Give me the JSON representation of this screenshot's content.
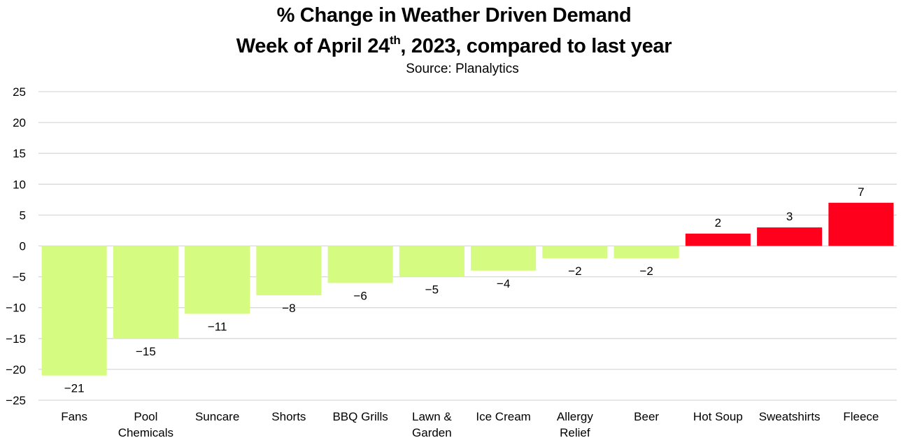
{
  "chart_data": {
    "type": "bar",
    "title": "% Change in Weather Driven Demand",
    "title_line2_pre": "Week of April 24",
    "title_line2_sup": "th",
    "title_line2_post": ", 2023, compared to last year",
    "subtitle": "Source: Planalytics",
    "xlabel": "",
    "ylabel": "",
    "ylim": [
      -25,
      25
    ],
    "yticks": [
      25,
      20,
      15,
      10,
      5,
      0,
      -5,
      -10,
      -15,
      -20,
      -25
    ],
    "grid": true,
    "legend": "none",
    "categories": [
      [
        "Fans"
      ],
      [
        "Pool",
        "Chemicals"
      ],
      [
        "Suncare"
      ],
      [
        "Shorts"
      ],
      [
        "BBQ Grills"
      ],
      [
        "Lawn &",
        "Garden"
      ],
      [
        "Ice Cream"
      ],
      [
        "Allergy",
        "Relief"
      ],
      [
        "Beer"
      ],
      [
        "Hot Soup"
      ],
      [
        "Sweatshirts"
      ],
      [
        "Fleece"
      ]
    ],
    "values": [
      -21,
      -15,
      -11,
      -8,
      -6,
      -5,
      -4,
      -2,
      -2,
      2,
      3,
      7
    ],
    "colors": {
      "negative": "#d5fb80",
      "positive": "#ff001c",
      "grid": "#d9d9d9"
    }
  }
}
